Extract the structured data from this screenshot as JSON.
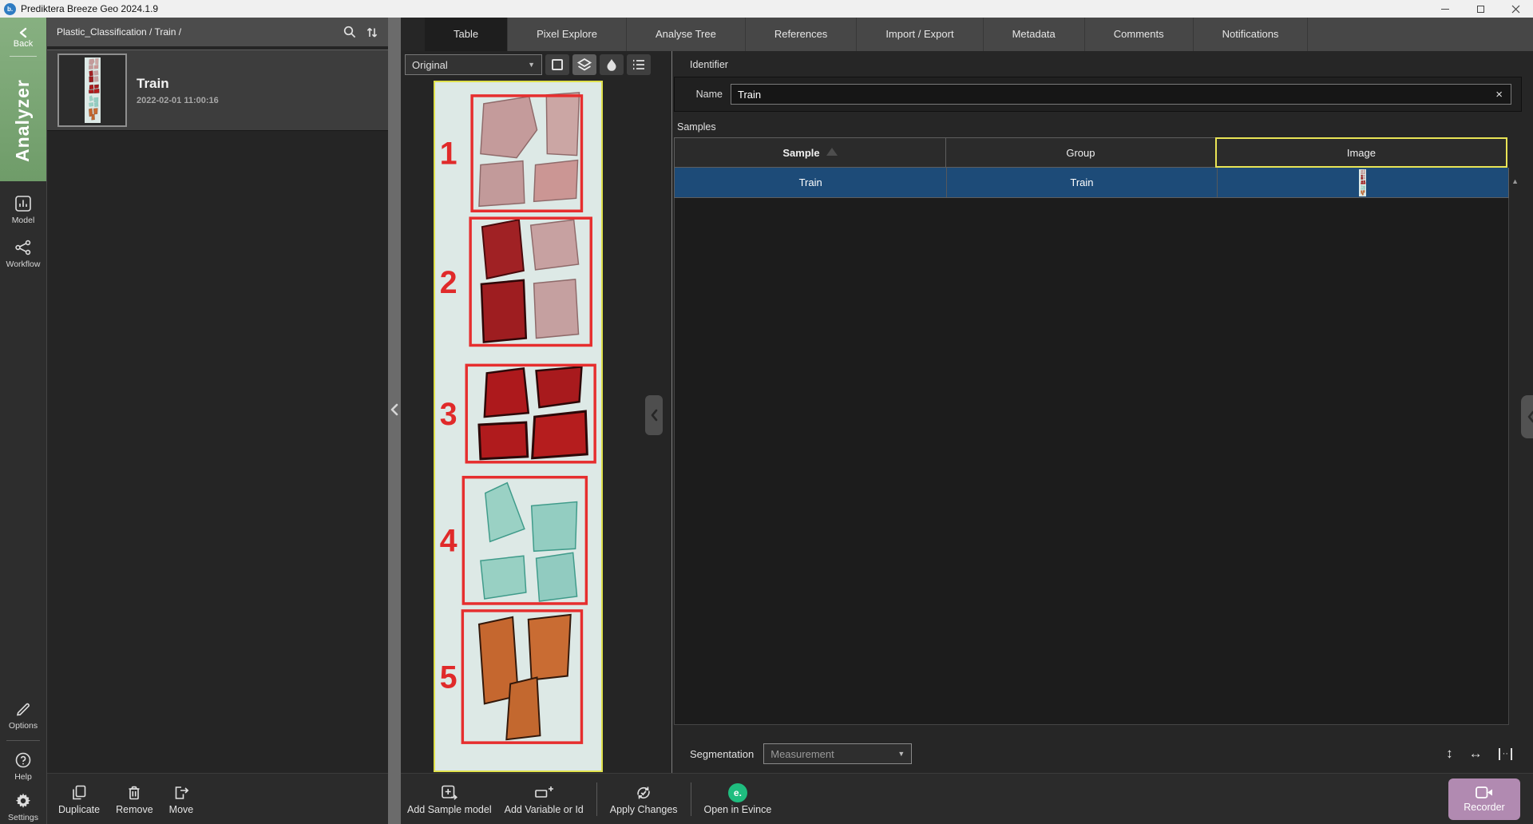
{
  "window": {
    "title": "Prediktera Breeze Geo 2024.1.9"
  },
  "sidebar": {
    "back_label": "Back",
    "mode_label": "Analyzer",
    "nav_items": [
      {
        "label": "Model",
        "icon": "model-chart-icon"
      },
      {
        "label": "Workflow",
        "icon": "workflow-nodes-icon"
      }
    ],
    "bottom_items": [
      {
        "label": "Options",
        "icon": "pencil-icon"
      },
      {
        "label": "Help",
        "icon": "help-circle-icon"
      },
      {
        "label": "Settings",
        "icon": "gear-icon"
      }
    ]
  },
  "file_panel": {
    "breadcrumb": "Plastic_Classification / Train /",
    "header_icons": [
      "search-icon",
      "sort-icon"
    ],
    "items": [
      {
        "title": "Train",
        "timestamp": "2022-02-01 11:00:16"
      }
    ],
    "toolbar": [
      {
        "label": "Duplicate",
        "icon": "duplicate-icon"
      },
      {
        "label": "Remove",
        "icon": "trash-icon"
      },
      {
        "label": "Move",
        "icon": "move-icon"
      }
    ]
  },
  "tabs": [
    {
      "label": "Table",
      "active": true
    },
    {
      "label": "Pixel Explore",
      "active": false
    },
    {
      "label": "Analyse Tree",
      "active": false
    },
    {
      "label": "References",
      "active": false
    },
    {
      "label": "Import / Export",
      "active": false
    },
    {
      "label": "Metadata",
      "active": false
    },
    {
      "label": "Comments",
      "active": false
    },
    {
      "label": "Notifications",
      "active": false
    }
  ],
  "viewer": {
    "layer_select_value": "Original",
    "layer_select_caret": "▼",
    "tool_icons": [
      "selection-square-icon",
      "layers-icon",
      "contrast-drop-icon",
      "list-icon"
    ],
    "regions": [
      {
        "number": "1"
      },
      {
        "number": "2"
      },
      {
        "number": "3"
      },
      {
        "number": "4"
      },
      {
        "number": "5"
      }
    ]
  },
  "detail": {
    "identifier_heading": "Identifier",
    "name_label": "Name",
    "name_value": "Train",
    "name_clear": "×",
    "samples_heading": "Samples",
    "table": {
      "columns": [
        "Sample",
        "Group",
        "Image"
      ],
      "rows": [
        {
          "sample": "Train",
          "group": "Train",
          "image": "strip-thumbnail"
        }
      ],
      "scroll_up_glyph": "▲"
    },
    "segmentation_label": "Segmentation",
    "segmentation_value": "Measurement",
    "segmentation_caret": "▼",
    "resize_icons": [
      {
        "name": "resize-vertical-icon",
        "glyph": "↕"
      },
      {
        "name": "resize-horizontal-icon",
        "glyph": "↔"
      },
      {
        "name": "resize-columns-icon",
        "glyph": "··"
      }
    ]
  },
  "actions": [
    {
      "label": "Add Sample model",
      "icon": "add-sample-model-icon"
    },
    {
      "label": "Add Variable or Id",
      "icon": "add-variable-icon"
    },
    {
      "label": "Apply Changes",
      "icon": "apply-changes-icon"
    },
    {
      "label": "Open in Evince",
      "icon": "evince-icon",
      "badge": "e."
    }
  ],
  "recorder": {
    "label": "Recorder",
    "icon": "video-camera-icon"
  },
  "colors": {
    "accent_green": "#7ba476",
    "selection_blue": "#1d4b78",
    "focus_yellow": "#e9e455",
    "annotation_red": "#e62e2e",
    "recorder_mauve": "#b18ab1",
    "evince_green": "#1fbd7f"
  }
}
